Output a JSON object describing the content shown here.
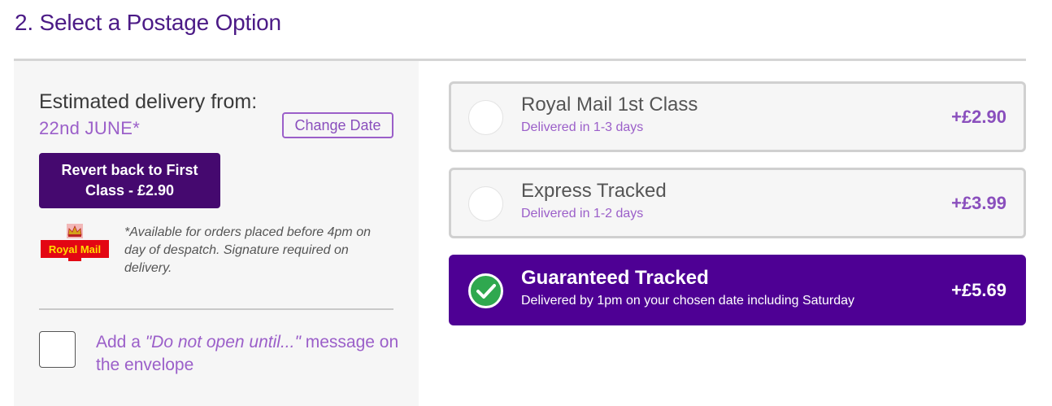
{
  "section": {
    "title": "2. Select a Postage Option"
  },
  "delivery": {
    "label": "Estimated delivery from:",
    "date": "22nd JUNE*",
    "change_date_label": "Change Date",
    "revert_label": "Revert back to First Class - £2.90"
  },
  "royal_mail": {
    "logo_text": "Royal Mail",
    "note": "*Available for orders placed before 4pm on day of despatch. Signature required on delivery."
  },
  "message_option": {
    "prefix": "Add a ",
    "quote": "\"Do not open until...\"",
    "suffix": " message on the envelope",
    "checked": false
  },
  "options": [
    {
      "title": "Royal Mail 1st Class",
      "subtitle": "Delivered in 1-3 days",
      "price": "+£2.90",
      "selected": false
    },
    {
      "title": "Express Tracked",
      "subtitle": "Delivered in 1-2 days",
      "price": "+£3.99",
      "selected": false
    },
    {
      "title": "Guaranteed Tracked",
      "subtitle": "Delivered by 1pm on your chosen date including Saturday",
      "price": "+£5.69",
      "selected": true
    }
  ],
  "colors": {
    "brand_purple": "#4e0094",
    "button_purple": "#45096f",
    "accent_lilac": "#9b5fc9",
    "check_green": "#2fa84f",
    "royal_mail_red": "#e30613",
    "royal_mail_yellow": "#ffdd00"
  },
  "icons": {
    "selected": "check-icon",
    "logo": "royal-mail-crown-logo"
  }
}
